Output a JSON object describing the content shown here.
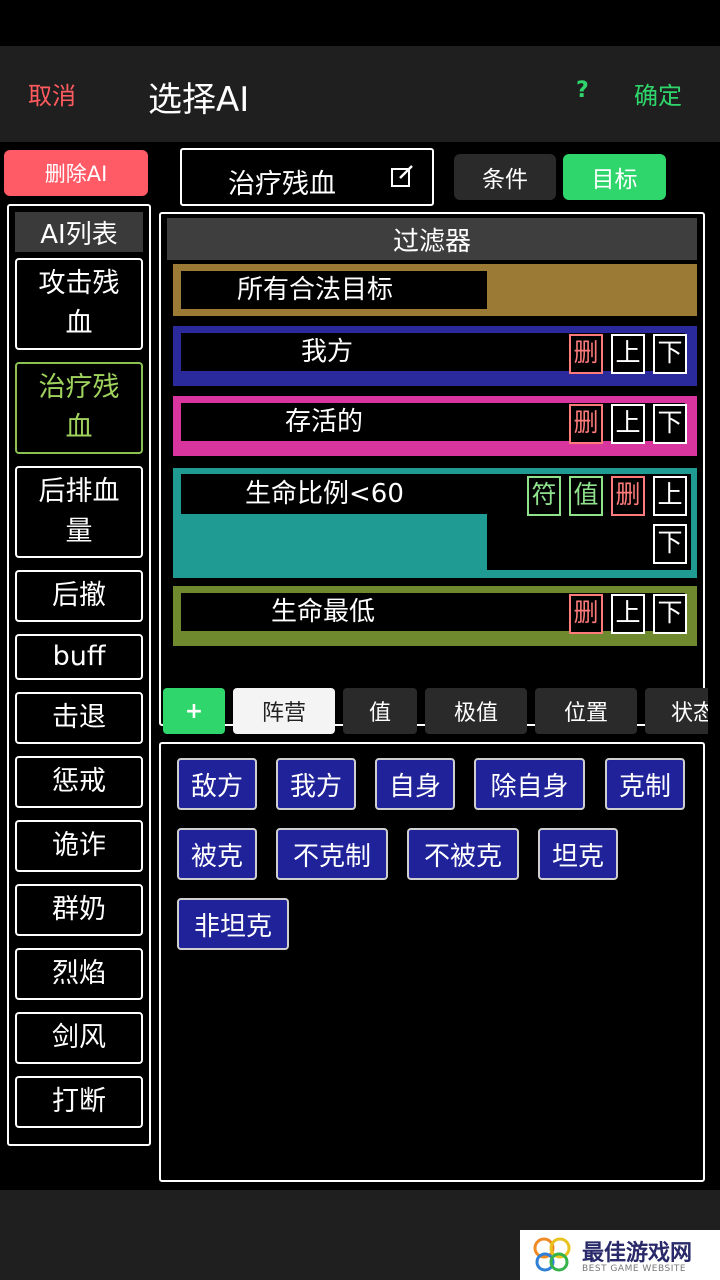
{
  "header": {
    "cancel_label": "取消",
    "title": "选择AI",
    "help_label": "?",
    "confirm_label": "确定"
  },
  "sidebar": {
    "delete_label": "删除AI",
    "list_title": "AI列表",
    "items": [
      {
        "label": "攻击残血"
      },
      {
        "label": "治疗残血",
        "selected": true
      },
      {
        "label": "后排血量"
      },
      {
        "label": "后撤"
      },
      {
        "label": "buff"
      },
      {
        "label": "击退"
      },
      {
        "label": "惩戒"
      },
      {
        "label": "诡诈"
      },
      {
        "label": "群奶"
      },
      {
        "label": "烈焰"
      },
      {
        "label": "剑风"
      },
      {
        "label": "打断"
      }
    ]
  },
  "editor": {
    "name": "治疗残血",
    "edit_icon": "edit-icon",
    "tab_condition": "条件",
    "tab_target": "目标"
  },
  "filters": {
    "title": "过滤器",
    "delete_label": "删",
    "up_label": "上",
    "down_label": "下",
    "symbol_label": "符",
    "value_label": "值",
    "rows": [
      {
        "label": "所有合法目标",
        "color": "#9a7a34"
      },
      {
        "label": "我方",
        "color": "#2a2a9c"
      },
      {
        "label": "存活的",
        "color": "#d9359e"
      },
      {
        "label": "生命比例<60",
        "color": "#1f9b93"
      },
      {
        "label": "生命最低",
        "color": "#6f8a2e"
      }
    ]
  },
  "categories": {
    "add_label": "+",
    "items": [
      "阵营",
      "值",
      "极值",
      "位置",
      "状态"
    ],
    "active": "阵营"
  },
  "options": [
    "敌方",
    "我方",
    "自身",
    "除自身",
    "克制",
    "被克",
    "不克制",
    "不被克",
    "坦克",
    "非坦克"
  ],
  "watermark": {
    "title": "最佳游戏网",
    "subtitle": "BEST GAME WEBSITE",
    "icon": "butterfly-logo-icon"
  },
  "colors": {
    "accent_green": "#2fd66b",
    "cancel_red": "#ff5b5f",
    "delete_button": "#ff5b67",
    "option_blue": "#1f2299",
    "selected_item": "#9fd35d"
  }
}
